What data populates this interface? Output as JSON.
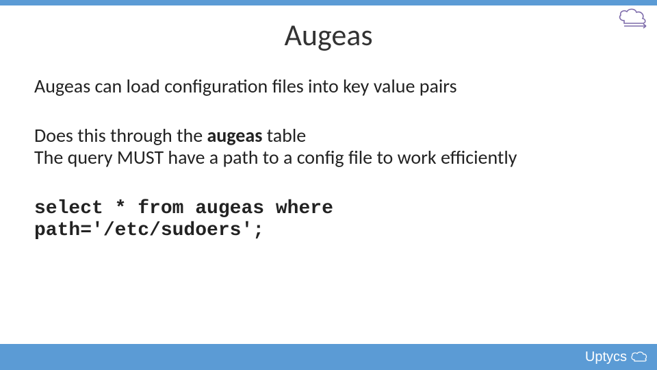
{
  "title": "Augeas",
  "para1": "Augeas can load configuration files into key value pairs",
  "para2_pre": "Does this through the ",
  "para2_bold": "augeas",
  "para2_post": " table",
  "para2_line2": "The query MUST have a path to a config file to work efficiently",
  "code_line1": "select * from augeas where",
  "code_line2": "path='/etc/sudoers';",
  "brand": "Uptycs",
  "icons": {
    "cloud_top": "cloud-arrow-icon",
    "cloud_brand": "cloud-icon"
  }
}
